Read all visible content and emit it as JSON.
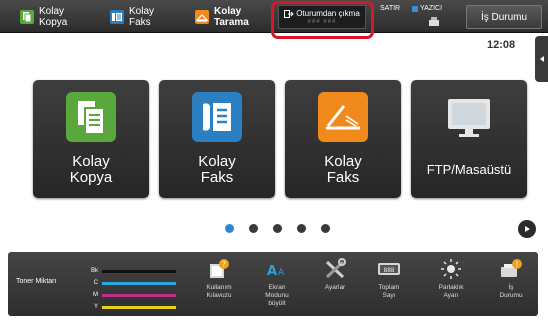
{
  "topbar": {
    "items": [
      {
        "label": "Kolay\nKopya",
        "color": "#5aa83c",
        "icon": "copy-icon"
      },
      {
        "label": "Kolay\nFaks",
        "color": "#2c7fc1",
        "icon": "fax-icon"
      },
      {
        "label": "Kolay\nTarama",
        "color": "#f08a1c",
        "icon": "scan-icon"
      }
    ],
    "logout_label": "Oturumdan çıkma",
    "logout_sub": "### ###",
    "status_line": "SATIR",
    "printer_label": "YAZICI",
    "job_status_label": "İş Durumu"
  },
  "clock": "12:08",
  "tiles": [
    {
      "label": "Kolay\nKopya",
      "color": "#5aa83c",
      "icon": "copy-icon"
    },
    {
      "label": "Kolay\nFaks",
      "color": "#2c7fc1",
      "icon": "fax-icon"
    },
    {
      "label": "Kolay\nFaks",
      "color": "#f08a1c",
      "icon": "scan-icon"
    },
    {
      "label": "FTP/Masaüstü",
      "color": "#e6e6e6",
      "icon": "monitor-icon"
    }
  ],
  "pager": {
    "pages": 5,
    "active": 1
  },
  "toner": {
    "label": "Toner Miktarı",
    "rows": [
      {
        "key": "Bk",
        "color": "#111111"
      },
      {
        "key": "C",
        "color": "#2aa7dd"
      },
      {
        "key": "M",
        "color": "#c0308a"
      },
      {
        "key": "Y",
        "color": "#e2d21c"
      }
    ]
  },
  "bottom_items": [
    {
      "label": "Kullanım\nKılavuzu",
      "icon": "manual-icon"
    },
    {
      "label": "Ekran\nModunu\nbüyült",
      "icon": "enlarge-text-icon"
    },
    {
      "label": "Ayarlar",
      "icon": "settings-tools-icon"
    },
    {
      "label": "Toplam\nSayı",
      "icon": "counter-icon"
    },
    {
      "label": "Parlaklık\nAyarı",
      "icon": "brightness-icon"
    },
    {
      "label": "İş\nDurumu",
      "icon": "job-status-icon"
    }
  ]
}
